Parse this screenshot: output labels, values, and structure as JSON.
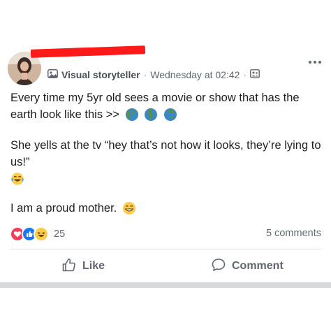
{
  "post": {
    "author_badge": "Visual storyteller",
    "separator": "·",
    "timestamp": "Wednesday at 02:42",
    "privacy_icon": "friends-privacy-icon",
    "text_line1": "Every time my 5yr old sees a movie or show that has the earth look like this >>",
    "text_line2": "She yells at the tv “hey that’s not how it looks, they’re lying to us!”",
    "text_line3": "I am a proud mother."
  },
  "reactions": {
    "types": [
      "love",
      "like",
      "haha"
    ],
    "count": "25",
    "comments_label": "5 comments"
  },
  "actions": {
    "like_label": "Like",
    "comment_label": "Comment"
  },
  "colors": {
    "like_blue": "#1877f2",
    "love_red": "#f33e58",
    "haha_yellow": "#fbcc4a",
    "meta_gray": "#606770",
    "redaction": "#ff1a1a"
  }
}
